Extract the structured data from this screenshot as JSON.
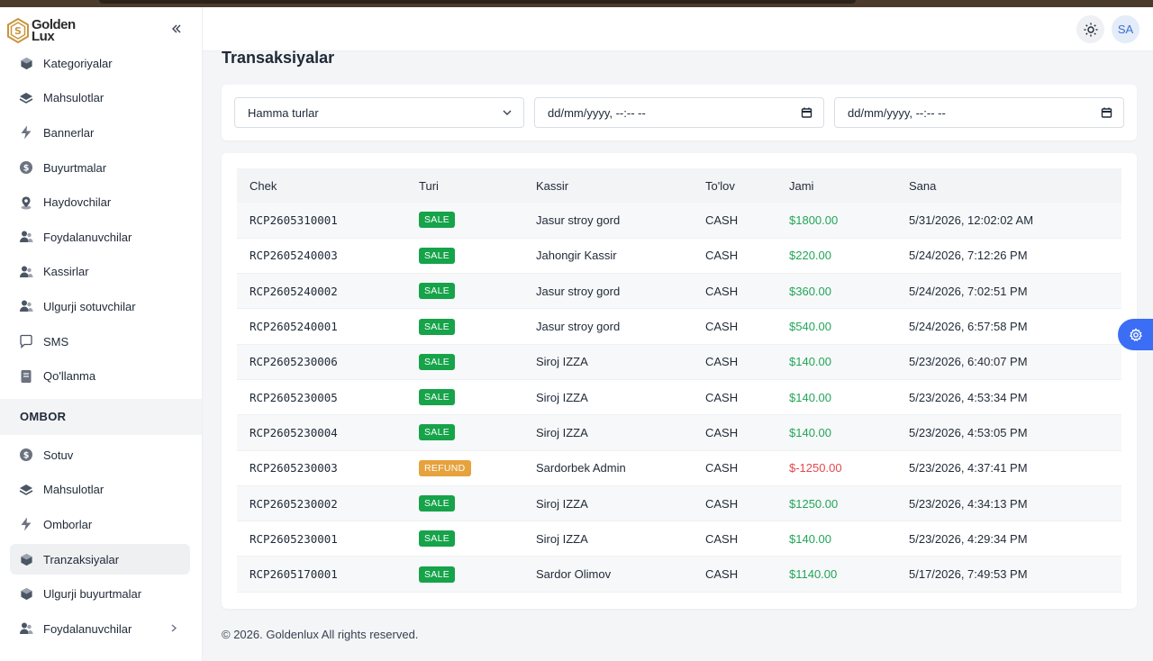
{
  "brand": {
    "line1": "Golden",
    "line2": "Lux"
  },
  "sidebar": {
    "items": [
      {
        "label": "Kategoriyalar",
        "icon": "cube-icon"
      },
      {
        "label": "Mahsulotlar",
        "icon": "layers-icon"
      },
      {
        "label": "Bannerlar",
        "icon": "bolt-icon"
      },
      {
        "label": "Buyurtmalar",
        "icon": "dollar-icon"
      },
      {
        "label": "Haydovchilar",
        "icon": "location-icon"
      },
      {
        "label": "Foydalanuvchilar",
        "icon": "users-icon"
      },
      {
        "label": "Kassirlar",
        "icon": "users-icon"
      },
      {
        "label": "Ulgurji sotuvchilar",
        "icon": "users-icon"
      },
      {
        "label": "SMS",
        "icon": "chat-icon"
      },
      {
        "label": "Qo'llanma",
        "icon": "book-icon"
      }
    ],
    "section_title": "OMBOR",
    "ombor_items": [
      {
        "label": "Sotuv",
        "icon": "dollar-icon"
      },
      {
        "label": "Mahsulotlar",
        "icon": "layers-icon"
      },
      {
        "label": "Omborlar",
        "icon": "bolt-icon"
      },
      {
        "label": "Tranzaksiyalar",
        "icon": "cube-icon",
        "active": true
      },
      {
        "label": "Ulgurji buyurtmalar",
        "icon": "cube-icon"
      },
      {
        "label": "Foydalanuvchilar",
        "icon": "users-icon",
        "has_children": true
      }
    ]
  },
  "header": {
    "avatar_initials": "SA"
  },
  "page": {
    "title": "Transaksiyalar"
  },
  "filters": {
    "type_select": "Hamma turlar",
    "date_from": "dd/mm/yyyy, --:-- --",
    "date_to": "dd/mm/yyyy, --:-- --"
  },
  "table": {
    "headers": [
      "Chek",
      "Turi",
      "Kassir",
      "To'lov",
      "Jami",
      "Sana"
    ],
    "rows": [
      {
        "chek": "RCP2605310001",
        "turi": "SALE",
        "kassir": "Jasur stroy gord",
        "tolov": "CASH",
        "jami": "$1800.00",
        "sana": "5/31/2026, 12:02:02 AM"
      },
      {
        "chek": "RCP2605240003",
        "turi": "SALE",
        "kassir": "Jahongir Kassir",
        "tolov": "CASH",
        "jami": "$220.00",
        "sana": "5/24/2026, 7:12:26 PM"
      },
      {
        "chek": "RCP2605240002",
        "turi": "SALE",
        "kassir": "Jasur stroy gord",
        "tolov": "CASH",
        "jami": "$360.00",
        "sana": "5/24/2026, 7:02:51 PM"
      },
      {
        "chek": "RCP2605240001",
        "turi": "SALE",
        "kassir": "Jasur stroy gord",
        "tolov": "CASH",
        "jami": "$540.00",
        "sana": "5/24/2026, 6:57:58 PM"
      },
      {
        "chek": "RCP2605230006",
        "turi": "SALE",
        "kassir": "Siroj IZZA",
        "tolov": "CASH",
        "jami": "$140.00",
        "sana": "5/23/2026, 6:40:07 PM"
      },
      {
        "chek": "RCP2605230005",
        "turi": "SALE",
        "kassir": "Siroj IZZA",
        "tolov": "CASH",
        "jami": "$140.00",
        "sana": "5/23/2026, 4:53:34 PM"
      },
      {
        "chek": "RCP2605230004",
        "turi": "SALE",
        "kassir": "Siroj IZZA",
        "tolov": "CASH",
        "jami": "$140.00",
        "sana": "5/23/2026, 4:53:05 PM"
      },
      {
        "chek": "RCP2605230003",
        "turi": "REFUND",
        "kassir": "Sardorbek Admin",
        "tolov": "CASH",
        "jami": "$-1250.00",
        "sana": "5/23/2026, 4:37:41 PM"
      },
      {
        "chek": "RCP2605230002",
        "turi": "SALE",
        "kassir": "Siroj IZZA",
        "tolov": "CASH",
        "jami": "$1250.00",
        "sana": "5/23/2026, 4:34:13 PM"
      },
      {
        "chek": "RCP2605230001",
        "turi": "SALE",
        "kassir": "Siroj IZZA",
        "tolov": "CASH",
        "jami": "$140.00",
        "sana": "5/23/2026, 4:29:34 PM"
      },
      {
        "chek": "RCP2605170001",
        "turi": "SALE",
        "kassir": "Sardor Olimov",
        "tolov": "CASH",
        "jami": "$1140.00",
        "sana": "5/17/2026, 7:49:53 PM"
      }
    ]
  },
  "footer": {
    "text": "© 2026. Goldenlux All rights reserved."
  },
  "colors": {
    "sale": "#16a34a",
    "refund": "#e6a23c",
    "positive": "#22a55a",
    "negative": "#e5484d",
    "accent": "#3b6ef5"
  }
}
